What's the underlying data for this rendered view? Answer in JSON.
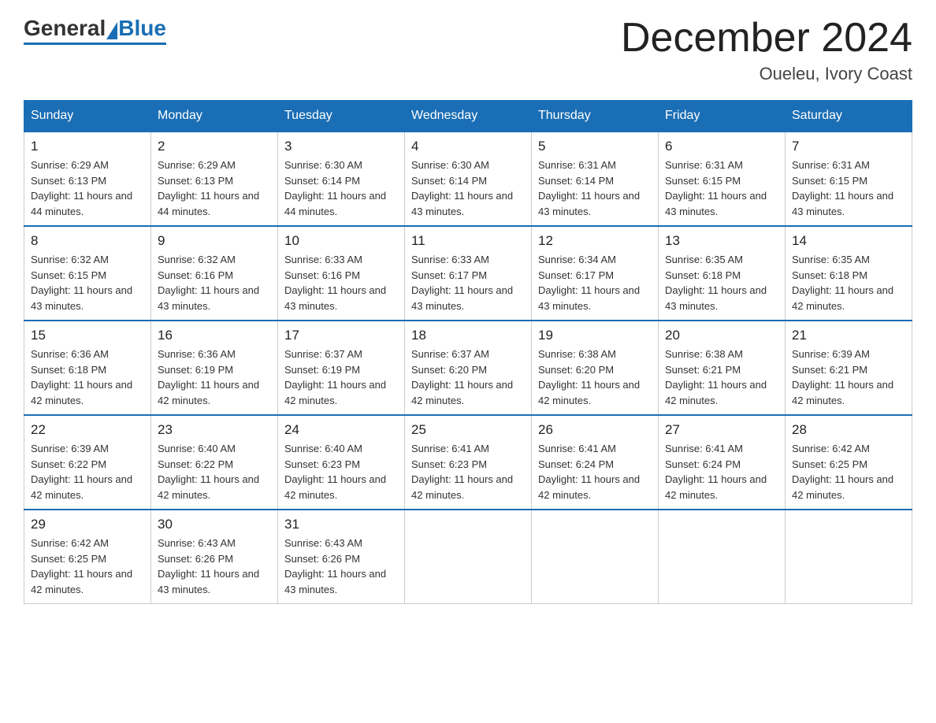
{
  "header": {
    "logo_general": "General",
    "logo_blue": "Blue",
    "month_title": "December 2024",
    "location": "Oueleu, Ivory Coast"
  },
  "weekdays": [
    "Sunday",
    "Monday",
    "Tuesday",
    "Wednesday",
    "Thursday",
    "Friday",
    "Saturday"
  ],
  "weeks": [
    [
      {
        "day": "1",
        "sunrise": "6:29 AM",
        "sunset": "6:13 PM",
        "daylight": "11 hours and 44 minutes."
      },
      {
        "day": "2",
        "sunrise": "6:29 AM",
        "sunset": "6:13 PM",
        "daylight": "11 hours and 44 minutes."
      },
      {
        "day": "3",
        "sunrise": "6:30 AM",
        "sunset": "6:14 PM",
        "daylight": "11 hours and 44 minutes."
      },
      {
        "day": "4",
        "sunrise": "6:30 AM",
        "sunset": "6:14 PM",
        "daylight": "11 hours and 43 minutes."
      },
      {
        "day": "5",
        "sunrise": "6:31 AM",
        "sunset": "6:14 PM",
        "daylight": "11 hours and 43 minutes."
      },
      {
        "day": "6",
        "sunrise": "6:31 AM",
        "sunset": "6:15 PM",
        "daylight": "11 hours and 43 minutes."
      },
      {
        "day": "7",
        "sunrise": "6:31 AM",
        "sunset": "6:15 PM",
        "daylight": "11 hours and 43 minutes."
      }
    ],
    [
      {
        "day": "8",
        "sunrise": "6:32 AM",
        "sunset": "6:15 PM",
        "daylight": "11 hours and 43 minutes."
      },
      {
        "day": "9",
        "sunrise": "6:32 AM",
        "sunset": "6:16 PM",
        "daylight": "11 hours and 43 minutes."
      },
      {
        "day": "10",
        "sunrise": "6:33 AM",
        "sunset": "6:16 PM",
        "daylight": "11 hours and 43 minutes."
      },
      {
        "day": "11",
        "sunrise": "6:33 AM",
        "sunset": "6:17 PM",
        "daylight": "11 hours and 43 minutes."
      },
      {
        "day": "12",
        "sunrise": "6:34 AM",
        "sunset": "6:17 PM",
        "daylight": "11 hours and 43 minutes."
      },
      {
        "day": "13",
        "sunrise": "6:35 AM",
        "sunset": "6:18 PM",
        "daylight": "11 hours and 43 minutes."
      },
      {
        "day": "14",
        "sunrise": "6:35 AM",
        "sunset": "6:18 PM",
        "daylight": "11 hours and 42 minutes."
      }
    ],
    [
      {
        "day": "15",
        "sunrise": "6:36 AM",
        "sunset": "6:18 PM",
        "daylight": "11 hours and 42 minutes."
      },
      {
        "day": "16",
        "sunrise": "6:36 AM",
        "sunset": "6:19 PM",
        "daylight": "11 hours and 42 minutes."
      },
      {
        "day": "17",
        "sunrise": "6:37 AM",
        "sunset": "6:19 PM",
        "daylight": "11 hours and 42 minutes."
      },
      {
        "day": "18",
        "sunrise": "6:37 AM",
        "sunset": "6:20 PM",
        "daylight": "11 hours and 42 minutes."
      },
      {
        "day": "19",
        "sunrise": "6:38 AM",
        "sunset": "6:20 PM",
        "daylight": "11 hours and 42 minutes."
      },
      {
        "day": "20",
        "sunrise": "6:38 AM",
        "sunset": "6:21 PM",
        "daylight": "11 hours and 42 minutes."
      },
      {
        "day": "21",
        "sunrise": "6:39 AM",
        "sunset": "6:21 PM",
        "daylight": "11 hours and 42 minutes."
      }
    ],
    [
      {
        "day": "22",
        "sunrise": "6:39 AM",
        "sunset": "6:22 PM",
        "daylight": "11 hours and 42 minutes."
      },
      {
        "day": "23",
        "sunrise": "6:40 AM",
        "sunset": "6:22 PM",
        "daylight": "11 hours and 42 minutes."
      },
      {
        "day": "24",
        "sunrise": "6:40 AM",
        "sunset": "6:23 PM",
        "daylight": "11 hours and 42 minutes."
      },
      {
        "day": "25",
        "sunrise": "6:41 AM",
        "sunset": "6:23 PM",
        "daylight": "11 hours and 42 minutes."
      },
      {
        "day": "26",
        "sunrise": "6:41 AM",
        "sunset": "6:24 PM",
        "daylight": "11 hours and 42 minutes."
      },
      {
        "day": "27",
        "sunrise": "6:41 AM",
        "sunset": "6:24 PM",
        "daylight": "11 hours and 42 minutes."
      },
      {
        "day": "28",
        "sunrise": "6:42 AM",
        "sunset": "6:25 PM",
        "daylight": "11 hours and 42 minutes."
      }
    ],
    [
      {
        "day": "29",
        "sunrise": "6:42 AM",
        "sunset": "6:25 PM",
        "daylight": "11 hours and 42 minutes."
      },
      {
        "day": "30",
        "sunrise": "6:43 AM",
        "sunset": "6:26 PM",
        "daylight": "11 hours and 43 minutes."
      },
      {
        "day": "31",
        "sunrise": "6:43 AM",
        "sunset": "6:26 PM",
        "daylight": "11 hours and 43 minutes."
      },
      null,
      null,
      null,
      null
    ]
  ]
}
